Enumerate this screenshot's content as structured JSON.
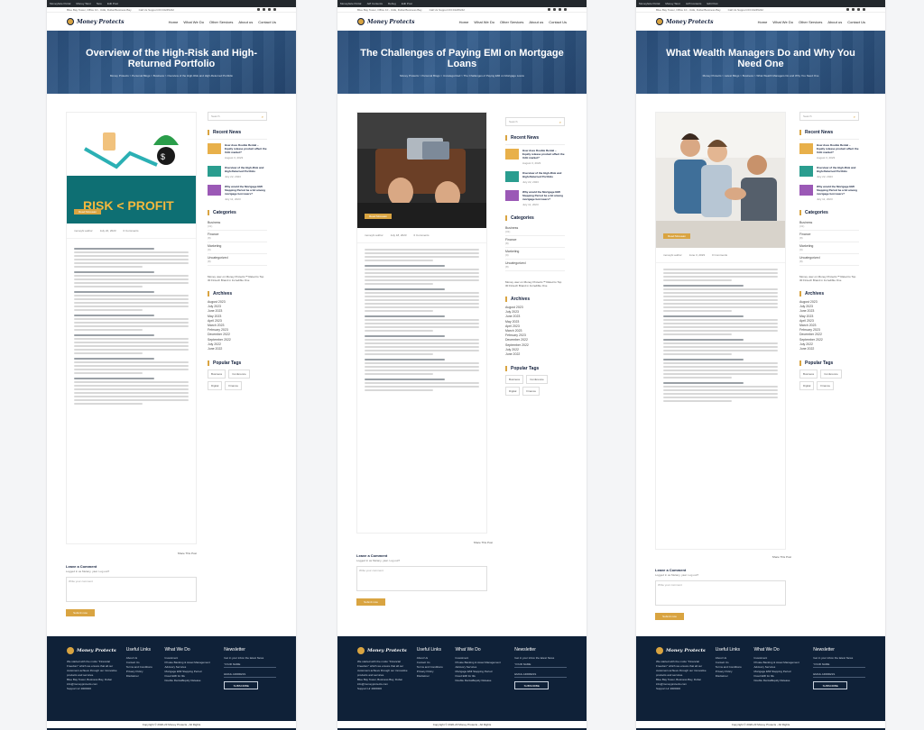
{
  "wp_admin_bar": [
    "Moneyfaze Portal",
    "Money Tarot",
    "Jeff Contents",
    "Debug",
    "New",
    "Edit Post"
  ],
  "top_info": {
    "address": "Blue Bay Tower, Office 10 - UAE, Dubai Business Bay",
    "phone": "Call Us Support 03 04245242"
  },
  "brand": {
    "logo_text": "Money Protects"
  },
  "nav": [
    "Home",
    "What We Do",
    "Other Services",
    "About us",
    "Contact Us"
  ],
  "search_placeholder": "Search",
  "widgets": {
    "recent_news": "Recent News",
    "categories": "Categories",
    "archives": "Archives",
    "popular_tags": "Popular Tags"
  },
  "recent_news": [
    {
      "title": "How does Double Rental – Equity release product affect the UAE market?",
      "date": "August 3, 2023"
    },
    {
      "title": "Overview of the High-Risk and High-Returned Portfolio",
      "date": "July 22, 2023"
    },
    {
      "title": "Why would the Mortgage EMI Stepping Period be a bit among mortgage borrowers?",
      "date": "July 11, 2023"
    }
  ],
  "categories": [
    {
      "name": "Business",
      "count": "(31)"
    },
    {
      "name": "Finance",
      "count": "(8)"
    },
    {
      "name": "Marketing",
      "count": "(9)"
    },
    {
      "name": "Uncategorized",
      "count": "(8)"
    }
  ],
  "comment_note": "Money user on Money Protects™ Rated to Top 30 Fintech Brand in Incredible One",
  "archives": [
    "August 2023",
    "July 2023",
    "June 2023",
    "May 2023",
    "April 2023",
    "March 2023",
    "February 2023",
    "December 2022",
    "September 2022",
    "July 2022",
    "June 2022"
  ],
  "tags": [
    "Business",
    "Conference",
    "Digital",
    "Finance"
  ],
  "meta": {
    "author": "moneyfx author",
    "comments": "0 Comments"
  },
  "read_more": "Read Moreaan",
  "share": "Share This Post",
  "leave_comment": {
    "title": "Leave a Comment",
    "note": "Logged in as Melany, yaar. Log out?",
    "placeholder": "Write your comment",
    "submit": "Submit now"
  },
  "footer": {
    "about": "We started with the motto \"Financial Freedom\" which we ensure that all our customers achieve through our innovative products and services.",
    "address": "Blue Bay Tower, Business Bay, Dubai",
    "email": "info@moneyprotects.com",
    "support": "Support Hr 4006000",
    "col_links_title": "Useful Links",
    "links": [
      "About Us",
      "Contact Us",
      "Terms and Conditions",
      "Privacy Policy",
      "Disclaimer"
    ],
    "col_what_title": "What We Do",
    "what": [
      "Investment",
      "Private Banking & Asset Management",
      "Advisory Services",
      "Mortgage EMI Stepping Period",
      "Fixed EMI for life",
      "Double Rental/Equity Release"
    ],
    "col_news_title": "Newsletter",
    "news_note": "Get in your inbox the latest News",
    "name_field": "YOUR NAME",
    "email_field": "EMAIL ADDRESS",
    "subscribe": "SUBSCRIBE",
    "copyright": "Copyright © 2020-23 Money Protects - All Rights"
  },
  "panels": [
    {
      "title": "Overview of the High-Risk and High-Returned Portfolio",
      "crumb": "Money Protects > Personal Blogs > Business > Overview of the High-Risk and High-Returned Portfolio",
      "date": "July 22, 2023",
      "feat_banner": "RISK < PROFIT"
    },
    {
      "title": "The Challenges of Paying EMI on Mortgage Loans",
      "crumb": "Money Protects > Personal Blogs > Uncategorized > The Challenges of Paying EMI on Mortgage Loans",
      "date": "July 18, 2023"
    },
    {
      "title": "What Wealth Managers Do and Why You Need One",
      "crumb": "Money Protects > Latest Blogs > Business > What Wealth Managers Do and Why You Need One",
      "date": "June 3, 2023"
    }
  ]
}
